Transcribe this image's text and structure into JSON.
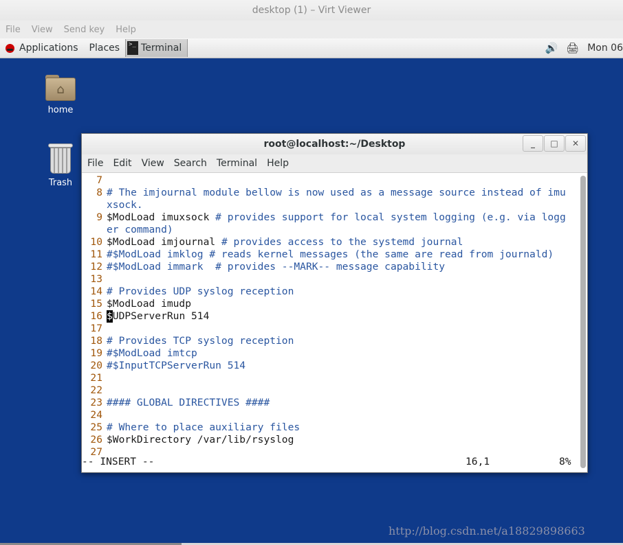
{
  "viewer": {
    "title": "desktop (1) – Virt Viewer",
    "menu": [
      "File",
      "View",
      "Send key",
      "Help"
    ]
  },
  "panel": {
    "applications": "Applications",
    "places": "Places",
    "task": "Terminal",
    "clock": "Mon 06"
  },
  "desktop": {
    "icons": [
      {
        "label": "home",
        "icon": "home-folder-icon"
      },
      {
        "label": "Trash",
        "icon": "trash-icon"
      }
    ],
    "background": "#0f3a8a"
  },
  "terminal": {
    "title": "root@localhost:~/Desktop",
    "menu": [
      "File",
      "Edit",
      "View",
      "Search",
      "Terminal",
      "Help"
    ],
    "lines": [
      {
        "num": "7",
        "text": "",
        "type": "tx"
      },
      {
        "num": "8",
        "text": "# The imjournal module bellow is now used as a message source instead of imu",
        "type": "cm"
      },
      {
        "num": "",
        "text": "xsock.",
        "type": "cm"
      },
      {
        "num": "9",
        "text": "$ModLoad imuxsock ",
        "type": "tx",
        "rest": "# provides support for local system logging (e.g. via logg"
      },
      {
        "num": "",
        "text": "er command)",
        "type": "cm"
      },
      {
        "num": "10",
        "text": "$ModLoad imjournal ",
        "type": "tx",
        "rest": "# provides access to the systemd journal"
      },
      {
        "num": "11",
        "text": "#$ModLoad imklog # reads kernel messages (the same are read from journald)",
        "type": "cm"
      },
      {
        "num": "12",
        "text": "#$ModLoad immark  # provides --MARK-- message capability",
        "type": "cm"
      },
      {
        "num": "13",
        "text": "",
        "type": "tx"
      },
      {
        "num": "14",
        "text": "# Provides UDP syslog reception",
        "type": "cm"
      },
      {
        "num": "15",
        "text": "$ModLoad imudp",
        "type": "tx"
      },
      {
        "num": "16",
        "text": "UDPServerRun 514",
        "type": "tx",
        "cursor": "$"
      },
      {
        "num": "17",
        "text": "",
        "type": "tx"
      },
      {
        "num": "18",
        "text": "# Provides TCP syslog reception",
        "type": "cm"
      },
      {
        "num": "19",
        "text": "#$ModLoad imtcp",
        "type": "cm"
      },
      {
        "num": "20",
        "text": "#$InputTCPServerRun 514",
        "type": "cm"
      },
      {
        "num": "21",
        "text": "",
        "type": "tx"
      },
      {
        "num": "22",
        "text": "",
        "type": "tx"
      },
      {
        "num": "23",
        "text": "#### GLOBAL DIRECTIVES ####",
        "type": "cm"
      },
      {
        "num": "24",
        "text": "",
        "type": "tx"
      },
      {
        "num": "25",
        "text": "# Where to place auxiliary files",
        "type": "cm"
      },
      {
        "num": "26",
        "text": "$WorkDirectory /var/lib/rsyslog",
        "type": "tx"
      },
      {
        "num": "27",
        "text": "",
        "type": "tx"
      }
    ],
    "status": {
      "mode": "-- INSERT --",
      "position": "16,1",
      "percent": "8%"
    }
  },
  "watermark": "http://blog.csdn.net/a18829898663"
}
